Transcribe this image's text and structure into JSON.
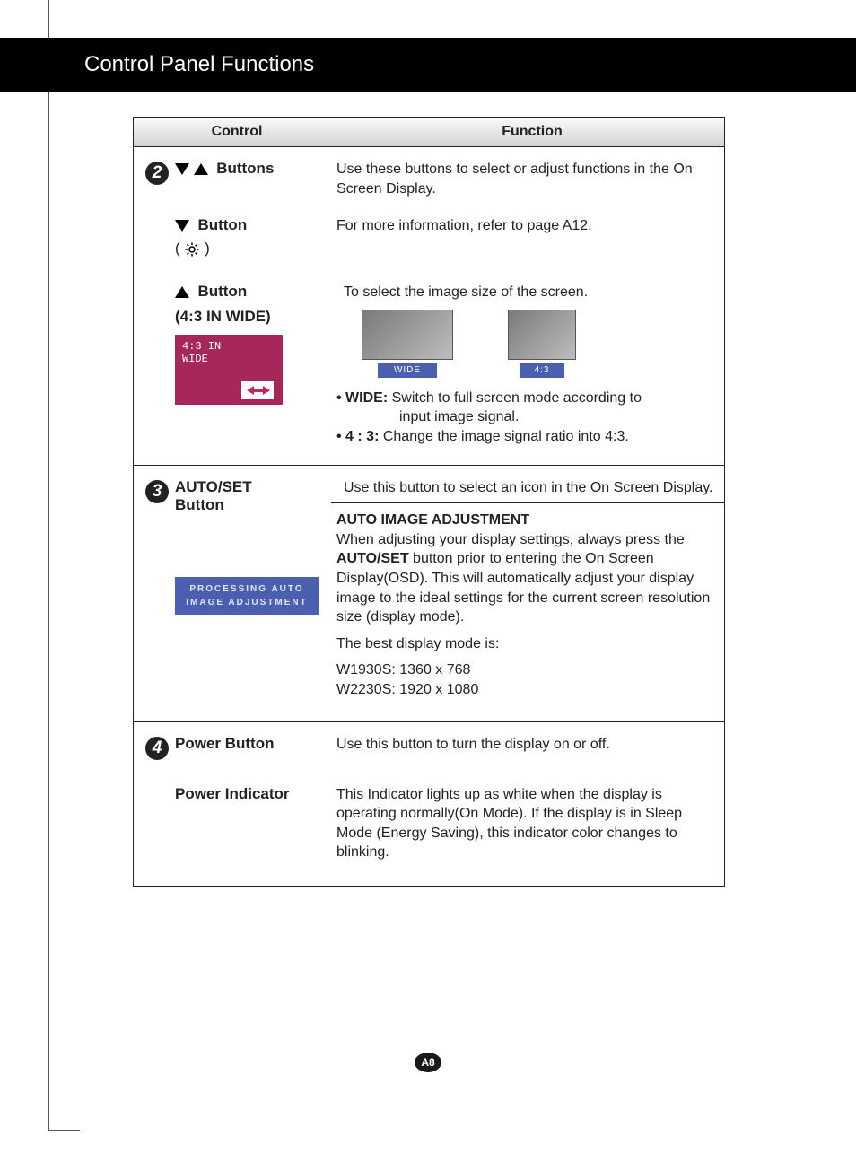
{
  "banner": {
    "title": "Control Panel Functions"
  },
  "table_header": {
    "control": "Control",
    "function": "Function"
  },
  "section2": {
    "num": "2",
    "buttons_label": "Buttons",
    "buttons_desc": "Use these buttons to select or adjust functions in the On Screen Display.",
    "down_label": "Button",
    "down_sub": "( ",
    "down_sub_close": " )",
    "down_desc": "For more information, refer to page A12.",
    "up_label": "Button",
    "up_sub": "(4:3 IN WIDE)",
    "up_desc": "To select the image size of the screen.",
    "osd_line1": "4:3  IN",
    "osd_line2": "WIDE",
    "thumbs": {
      "wide": "WIDE",
      "four_three": "4:3"
    },
    "bullet_wide_label": "• WIDE:",
    "bullet_wide_text": " Switch to full screen mode according to",
    "bullet_wide_text2": "input image signal.",
    "bullet_43_label": "• 4 : 3:",
    "bullet_43_text": " Change the image signal ratio into 4:3."
  },
  "section3": {
    "num": "3",
    "ctrl_label_1": "AUTO/SET",
    "ctrl_label_2": "Button",
    "top_desc": "Use this button to select an icon in the On Screen Display.",
    "auto_title": "AUTO IMAGE ADJUSTMENT",
    "auto_body_1": "When adjusting your display settings, always press the ",
    "auto_body_bold": "AUTO/SET",
    "auto_body_2": " button prior to entering the On Screen Display(OSD). This will automatically adjust your display image to the ideal settings for the current screen resolution size (display mode).",
    "best_mode": "The best display mode is:",
    "mode1": "W1930S: 1360 x 768",
    "mode2": "W2230S: 1920 x 1080",
    "proc_line1": "PROCESSING AUTO",
    "proc_line2": "IMAGE ADJUSTMENT"
  },
  "section4": {
    "num": "4",
    "power_btn_label": "Power Button",
    "power_btn_desc": "Use this button to turn the display on or off.",
    "power_ind_label": "Power Indicator",
    "power_ind_desc": "This Indicator lights up as white when the display is operating normally(On Mode). If the display is in Sleep Mode (Energy Saving), this indicator color changes to blinking."
  },
  "page_number": "A8"
}
